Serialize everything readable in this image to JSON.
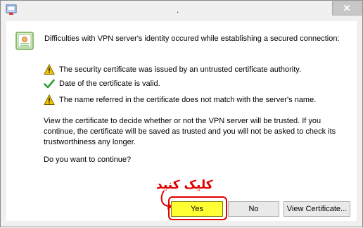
{
  "window": {
    "title": ".",
    "close_symbol": "✕"
  },
  "header": {
    "message": "Difficulties with VPN server's identity occured while establishing a secured connection:"
  },
  "checks": [
    {
      "status": "warning",
      "text": "The security certificate was issued by an untrusted certificate authority."
    },
    {
      "status": "ok",
      "text": "Date of the certificate is valid."
    },
    {
      "status": "warning",
      "text": "The name referred in the certificate does not match with the server's name."
    }
  ],
  "body": {
    "paragraph": "View the certificate to decide whether or not the VPN server will be trusted. If you continue, the certificate will be saved as trusted and you will not be asked to check its trustworthiness any longer.",
    "question": "Do you want to continue?"
  },
  "buttons": {
    "yes": "Yes",
    "no": "No",
    "view_certificate": "View Certificate..."
  },
  "annotation": {
    "text": "کلیک کنید",
    "color": "#e00000"
  },
  "colors": {
    "warning": "#f2c500",
    "ok": "#2e9e2e",
    "yes_fill": "#ffff33"
  }
}
